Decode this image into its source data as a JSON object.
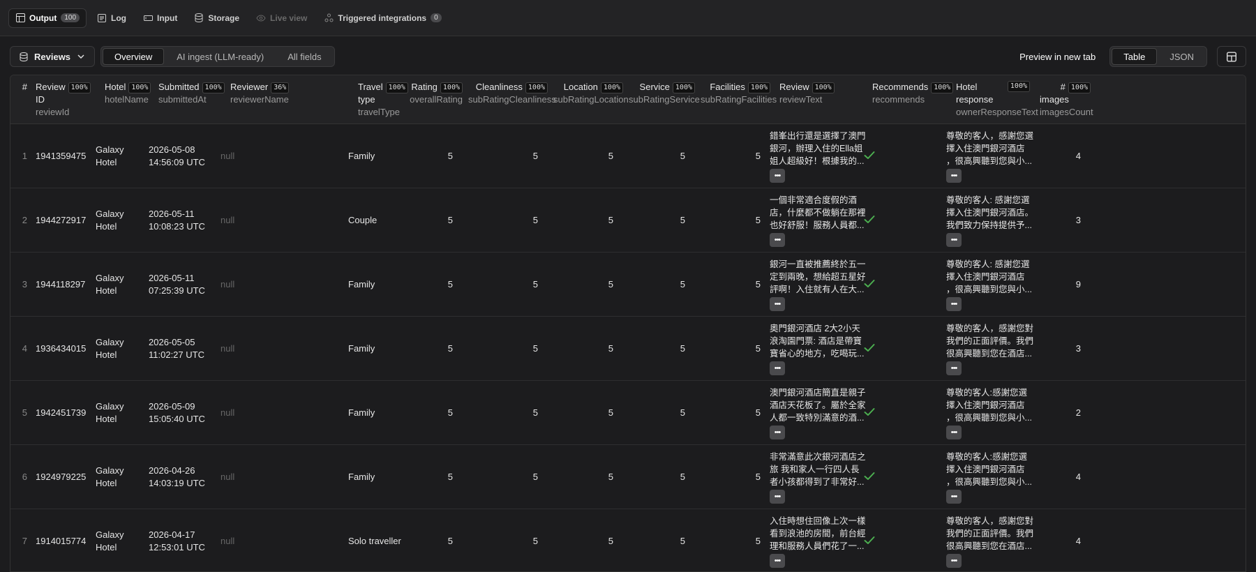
{
  "top_tabs": [
    {
      "label": "Output",
      "badge": "100",
      "icon": "table-icon"
    },
    {
      "label": "Log",
      "icon": "log-icon"
    },
    {
      "label": "Input",
      "icon": "input-icon"
    },
    {
      "label": "Storage",
      "icon": "storage-icon"
    },
    {
      "label": "Live view",
      "icon": "eye-icon"
    },
    {
      "label": "Triggered integrations",
      "badge": "0",
      "icon": "integration-icon"
    }
  ],
  "toolbar": {
    "dataset_label": "Reviews",
    "views": [
      "Overview",
      "AI ingest (LLM-ready)",
      "All fields"
    ],
    "selected_view": "Overview",
    "preview_label": "Preview in new tab",
    "formats": [
      "Table",
      "JSON"
    ],
    "selected_format": "Table"
  },
  "columns": [
    {
      "title": "#",
      "sub": ""
    },
    {
      "title": "Review",
      "title2": "ID",
      "pct": "100%",
      "sub": "reviewId"
    },
    {
      "title": "Hotel",
      "pct": "100%",
      "sub": "hotelName"
    },
    {
      "title": "Submitted",
      "pct": "100%",
      "sub": "submittedAt"
    },
    {
      "title": "Reviewer",
      "pct": "36%",
      "sub": "reviewerName"
    },
    {
      "title": "Travel",
      "title2": "type",
      "pct": "100%",
      "sub": "travelType"
    },
    {
      "title": "Rating",
      "pct": "100%",
      "sub": "overallRating"
    },
    {
      "title": "Cleanliness",
      "pct": "100%",
      "sub": "subRatingCleanliness"
    },
    {
      "title": "Location",
      "pct": "100%",
      "sub": "subRatingLocation"
    },
    {
      "title": "Service",
      "pct": "100%",
      "sub": "subRatingService"
    },
    {
      "title": "Facilities",
      "pct": "100%",
      "sub": "subRatingFacilities"
    },
    {
      "title": "Review",
      "pct": "100%",
      "sub": "reviewText"
    },
    {
      "title": "Recommends",
      "pct": "100%",
      "sub": "recommends"
    },
    {
      "title": "Hotel",
      "title2": "response",
      "pct": "100%",
      "sub": "ownerResponseText"
    },
    {
      "title": "#",
      "title2": "images",
      "pct": "100%",
      "sub": "imagesCount"
    }
  ],
  "rows": [
    {
      "n": "1",
      "id": "1941359475",
      "hotel1": "Galaxy",
      "hotel2": "Hotel",
      "date": "2026-05-08",
      "time": "14:56:09 UTC",
      "reviewer": "null",
      "travel": "Family",
      "rating": "5",
      "clean": "5",
      "loc": "5",
      "serv": "5",
      "fac": "5",
      "text": [
        "錯峯出行還是選擇了澳門",
        "銀河，辦理入住的Ella姐",
        "姐人超級好！根據我的..."
      ],
      "resp": [
        "尊敬的客人，感謝您選",
        "擇入住澳門銀河酒店",
        "，很高興聽到您與小..."
      ],
      "images": "4"
    },
    {
      "n": "2",
      "id": "1944272917",
      "hotel1": "Galaxy",
      "hotel2": "Hotel",
      "date": "2026-05-11",
      "time": "10:08:23 UTC",
      "reviewer": "null",
      "travel": "Couple",
      "rating": "5",
      "clean": "5",
      "loc": "5",
      "serv": "5",
      "fac": "5",
      "text": [
        "一個非常適合度假的酒",
        "店，什麼都不做躺在那裡",
        "也好舒服！服務人員都..."
      ],
      "resp": [
        "尊敬的客人: 感謝您選",
        "擇入住澳門銀河酒店。",
        "我們致力保持提供予..."
      ],
      "images": "3"
    },
    {
      "n": "3",
      "id": "1944118297",
      "hotel1": "Galaxy",
      "hotel2": "Hotel",
      "date": "2026-05-11",
      "time": "07:25:39 UTC",
      "reviewer": "null",
      "travel": "Family",
      "rating": "5",
      "clean": "5",
      "loc": "5",
      "serv": "5",
      "fac": "5",
      "text": [
        "銀河一直被推薦終於五一",
        "定到兩晚，想給超五星好",
        "評啊！入住就有人在大..."
      ],
      "resp": [
        "尊敬的客人: 感謝您選",
        "擇入住澳門銀河酒店",
        "，很高興聽到您與小..."
      ],
      "images": "9"
    },
    {
      "n": "4",
      "id": "1936434015",
      "hotel1": "Galaxy",
      "hotel2": "Hotel",
      "date": "2026-05-05",
      "time": "11:02:27 UTC",
      "reviewer": "null",
      "travel": "Family",
      "rating": "5",
      "clean": "5",
      "loc": "5",
      "serv": "5",
      "fac": "5",
      "text": [
        "奧門銀河酒店 2大2小天",
        "浪淘園門票: 酒店是帶寶",
        "寶省心的地方，吃喝玩..."
      ],
      "resp": [
        "尊敬的客人，感謝您對",
        "我們的正面評價。我們",
        "很高興聽到您在酒店..."
      ],
      "images": "3"
    },
    {
      "n": "5",
      "id": "1942451739",
      "hotel1": "Galaxy",
      "hotel2": "Hotel",
      "date": "2026-05-09",
      "time": "15:05:40 UTC",
      "reviewer": "null",
      "travel": "Family",
      "rating": "5",
      "clean": "5",
      "loc": "5",
      "serv": "5",
      "fac": "5",
      "text": [
        "澳門銀河酒店簡直是親子",
        "酒店天花板了。屬於全家",
        "人都一致特別滿意的酒..."
      ],
      "resp": [
        "尊敬的客人:感謝您選",
        "擇入住澳門銀河酒店",
        "，很高興聽到您與小..."
      ],
      "images": "2"
    },
    {
      "n": "6",
      "id": "1924979225",
      "hotel1": "Galaxy",
      "hotel2": "Hotel",
      "date": "2026-04-26",
      "time": "14:03:19 UTC",
      "reviewer": "null",
      "travel": "Family",
      "rating": "5",
      "clean": "5",
      "loc": "5",
      "serv": "5",
      "fac": "5",
      "text": [
        "非常滿意此次銀河酒店之",
        "旅 我和家人一行四人長",
        "者小孩都得到了非常好..."
      ],
      "resp": [
        "尊敬的客人:感謝您選",
        "擇入住澳門銀河酒店",
        "，很高興聽到您與小..."
      ],
      "images": "4"
    },
    {
      "n": "7",
      "id": "1914015774",
      "hotel1": "Galaxy",
      "hotel2": "Hotel",
      "date": "2026-04-17",
      "time": "12:53:01 UTC",
      "reviewer": "null",
      "travel": "Solo traveller",
      "rating": "5",
      "clean": "5",
      "loc": "5",
      "serv": "5",
      "fac": "5",
      "text": [
        "入住時想住回像上次一樣",
        "看到浪池的房間，前台經",
        "理和服務人員們花了一..."
      ],
      "resp": [
        "尊敬的客人，感謝您對",
        "我們的正面評價。我們",
        "很高興聽到您在酒店..."
      ],
      "images": "4"
    }
  ]
}
